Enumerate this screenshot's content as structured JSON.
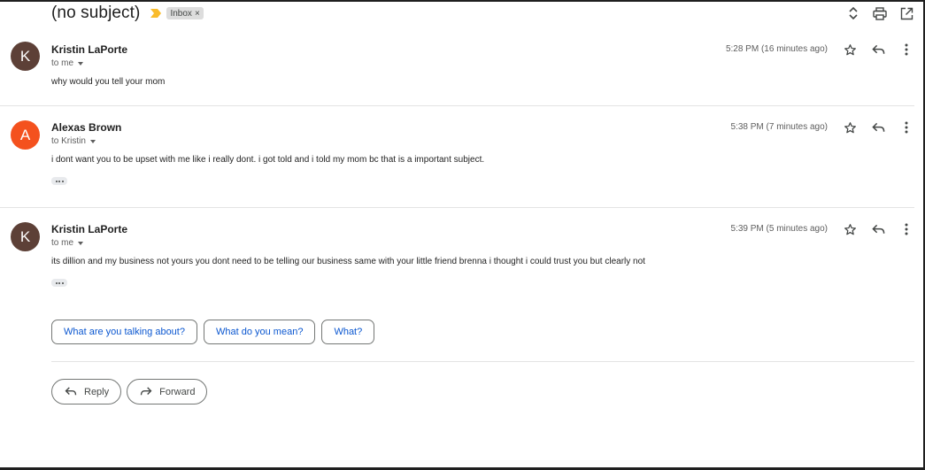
{
  "thread": {
    "subject": "(no subject)",
    "label": "Inbox",
    "label_remove": "×"
  },
  "icons": {
    "importance": "importance-marker-icon",
    "expand_collapse": "unfold-icon",
    "print": "print-icon",
    "open_new_window": "open-in-new-icon",
    "star": "star-icon",
    "reply": "reply-icon",
    "more": "more-vert-icon",
    "forward": "forward-icon"
  },
  "messages": [
    {
      "avatar_letter": "K",
      "avatar_color": "#5d4037",
      "sender": "Kristin LaPorte",
      "to": "to me",
      "time": "5:28 PM (16 minutes ago)",
      "body": "why would you tell your mom"
    },
    {
      "avatar_letter": "A",
      "avatar_color": "#f4511e",
      "sender": "Alexas Brown",
      "to": "to Kristin",
      "time": "5:38 PM (7 minutes ago)",
      "body": "i dont want you to be upset with me like i really dont. i got told and i told my mom bc that is a important subject."
    },
    {
      "avatar_letter": "K",
      "avatar_color": "#5d4037",
      "sender": "Kristin LaPorte",
      "to": "to me",
      "time": "5:39 PM (5 minutes ago)",
      "body": "its dillion and my business not yours you dont need to be telling our business same with your little friend brenna i thought i could trust you but clearly not"
    }
  ],
  "smart_replies": [
    "What are you talking about?",
    "What do you mean?",
    "What?"
  ],
  "actions": {
    "reply_label": "Reply",
    "forward_label": "Forward"
  },
  "colors": {
    "link_blue": "#0b57d0",
    "importance_yellow": "#f9bc2c"
  }
}
